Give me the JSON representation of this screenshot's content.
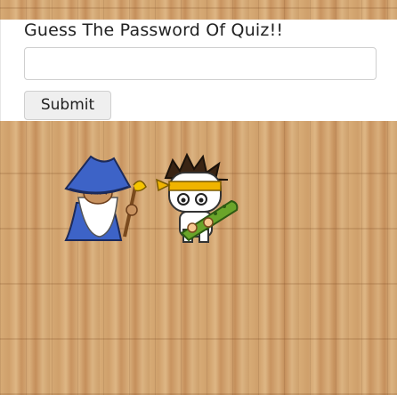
{
  "quiz": {
    "question": "Guess The Password Of Quiz!!",
    "answer_value": "",
    "answer_placeholder": ""
  },
  "buttons": {
    "submit_label": "Submit"
  },
  "sprites": {
    "wizard": "wizard-character",
    "ninja": "ninja-character-with-club"
  },
  "colors": {
    "wood": "#d3a670",
    "panel": "#ffffff",
    "wizard_robe": "#3d63c7",
    "headband": "#f0b400"
  }
}
